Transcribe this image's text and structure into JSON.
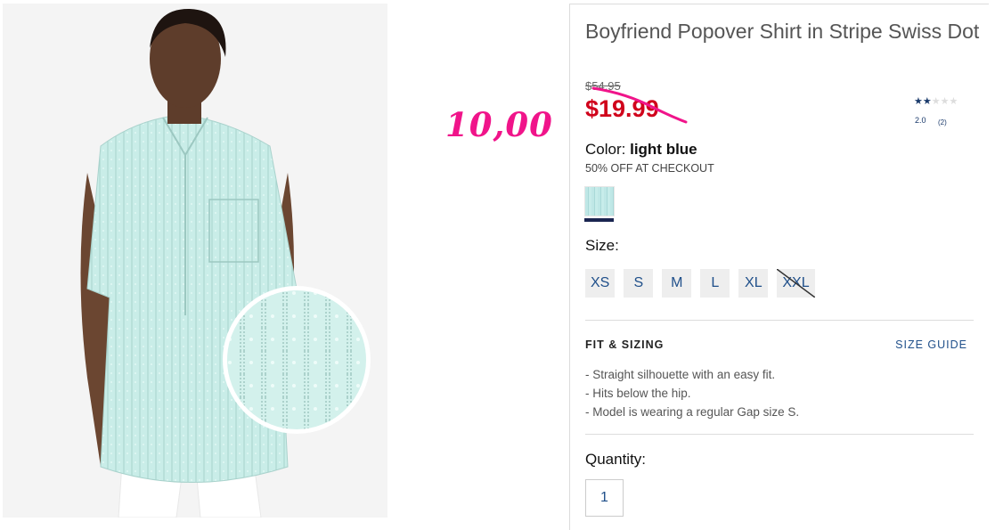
{
  "product": {
    "title": "Boyfriend Popover Shirt in Stripe Swiss Dot",
    "original_price": "$54.95",
    "sale_price": "$19.99",
    "annotated_price": "10,00",
    "rating": {
      "value": "2.0",
      "count": "(2)",
      "stars_filled": 2,
      "stars_total": 5
    },
    "color": {
      "label": "Color:",
      "value": "light blue"
    },
    "promo": "50% OFF AT CHECKOUT",
    "size_label": "Size:",
    "sizes": [
      {
        "label": "XS",
        "available": true
      },
      {
        "label": "S",
        "available": true
      },
      {
        "label": "M",
        "available": true
      },
      {
        "label": "L",
        "available": true
      },
      {
        "label": "XL",
        "available": true
      },
      {
        "label": "XXL",
        "available": false
      }
    ],
    "fit": {
      "heading": "FIT & SIZING",
      "size_guide": "SIZE GUIDE",
      "items": [
        "- Straight silhouette with an easy fit.",
        "- Hits below the hip.",
        "- Model is wearing a regular Gap size S."
      ]
    },
    "quantity": {
      "label": "Quantity:",
      "value": "1"
    }
  },
  "colors": {
    "sale_red": "#d0021b",
    "annotation_pink": "#f0148a",
    "link_blue": "#1f4f8a",
    "swatch_underline": "#1a2550"
  }
}
